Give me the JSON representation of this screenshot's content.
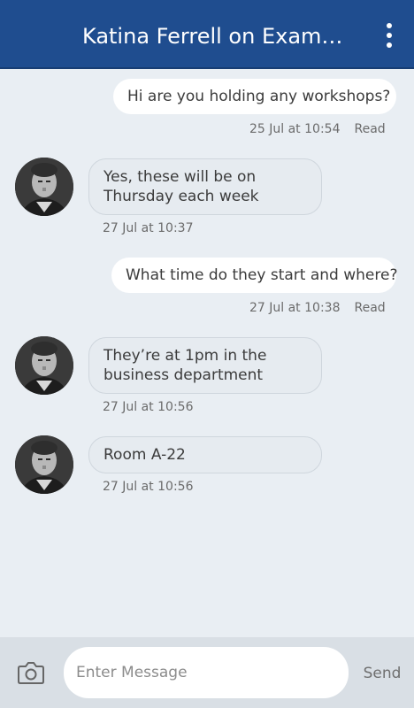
{
  "header": {
    "title": "Katina Ferrell on Exam…",
    "menu_icon": "more-vertical-icon"
  },
  "messages": [
    {
      "direction": "out",
      "text": "Hi are you holding any workshops?",
      "time": "25 Jul at 10:54",
      "status": "Read"
    },
    {
      "direction": "in",
      "text": "Yes, these will be on Thursday each week",
      "time": "27 Jul at 10:37"
    },
    {
      "direction": "out",
      "text": "What time do they start and where?",
      "time": "27 Jul at 10:38",
      "status": "Read"
    },
    {
      "direction": "in",
      "text": "They’re at 1pm in the business department",
      "time": "27 Jul at 10:56"
    },
    {
      "direction": "in",
      "text": "Room A-22",
      "time": "27 Jul at 10:56"
    }
  ],
  "composer": {
    "camera_icon": "camera-icon",
    "placeholder": "Enter Message",
    "value": "",
    "send_label": "Send"
  },
  "colors": {
    "header": "#1f4d8f",
    "background": "#e9eef3",
    "composer": "#d9dfe5"
  }
}
